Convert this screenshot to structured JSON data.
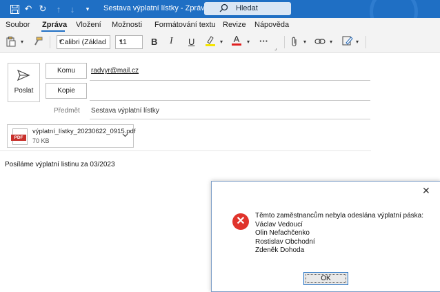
{
  "titlebar": {
    "title": "Sestava výplatní lístky  -  Zpráva (HT...",
    "search_placeholder": "Hledat"
  },
  "menu": {
    "items": [
      "Soubor",
      "Zpráva",
      "Vložení",
      "Možnosti",
      "Formátování textu",
      "Revize",
      "Nápověda"
    ],
    "active": "Zpráva"
  },
  "ribbon": {
    "font_name": "Calibri (Základ",
    "font_size": "11",
    "bold": "B",
    "italic": "I",
    "underline": "U",
    "font_color_letter": "A",
    "more": "···"
  },
  "compose": {
    "send_label": "Poslat",
    "to_button": "Komu",
    "cc_button": "Kopie",
    "to_value": "radvyr@mail.cz",
    "cc_value": "",
    "subject_label": "Předmět",
    "subject_value": "Sestava výplatní lístky"
  },
  "attachment": {
    "type_tag": "PDF",
    "name": "výplatní_lístky_20230622_0915.pdf",
    "size": "70 KB"
  },
  "body": {
    "text": "Posíláme výplatní listinu za 03/2023"
  },
  "dialog": {
    "close": "✕",
    "icon_symbol": "✕",
    "message_lines": [
      "Těmto zaměstnancům nebyla odeslána výplatní páska:",
      "Václav Vedoucí",
      "Olin Nefachčenko",
      "Rostislav Obchodní",
      "Zdeněk Dohoda"
    ],
    "ok_label": "OK"
  },
  "colors": {
    "titlebar": "#1f6fc4",
    "error": "#e0342c",
    "pdf": "#c8302b",
    "highlight": "#f5e400",
    "font_color": "#e02020"
  }
}
